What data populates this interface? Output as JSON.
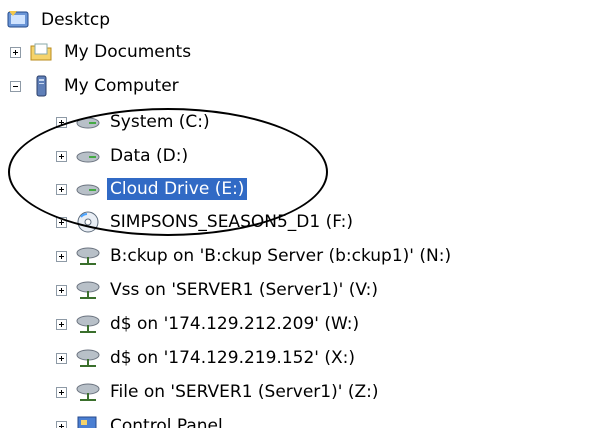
{
  "tree": {
    "desktop": "Desktcp",
    "my_documents": "My Documents",
    "my_computer": "My Computer",
    "drives": [
      {
        "label": "System (C:)",
        "icon": "hard-drive-icon"
      },
      {
        "label": "Data (D:)",
        "icon": "hard-drive-icon"
      },
      {
        "label": "Cloud Drive (E:)",
        "icon": "hard-drive-icon",
        "selected": true
      },
      {
        "label": "SIMPSONS_SEASON5_D1 (F:)",
        "icon": "cd-drive-icon"
      },
      {
        "label": "B:ckup on 'B:ckup Server (b:ckup1)' (N:)",
        "icon": "network-drive-icon"
      },
      {
        "label": "Vss on 'SERVER1 (Server1)' (V:)",
        "icon": "network-drive-icon"
      },
      {
        "label": "d$ on '174.129.212.209' (W:)",
        "icon": "network-drive-icon"
      },
      {
        "label": "d$ on '174.129.219.152' (X:)",
        "icon": "network-drive-icon"
      },
      {
        "label": "File on 'SERVER1 (Server1)' (Z:)",
        "icon": "network-drive-icon"
      }
    ],
    "control_panel": "Control Panel"
  },
  "colors": {
    "selection": "#316ac5",
    "annotation": "#000000"
  }
}
